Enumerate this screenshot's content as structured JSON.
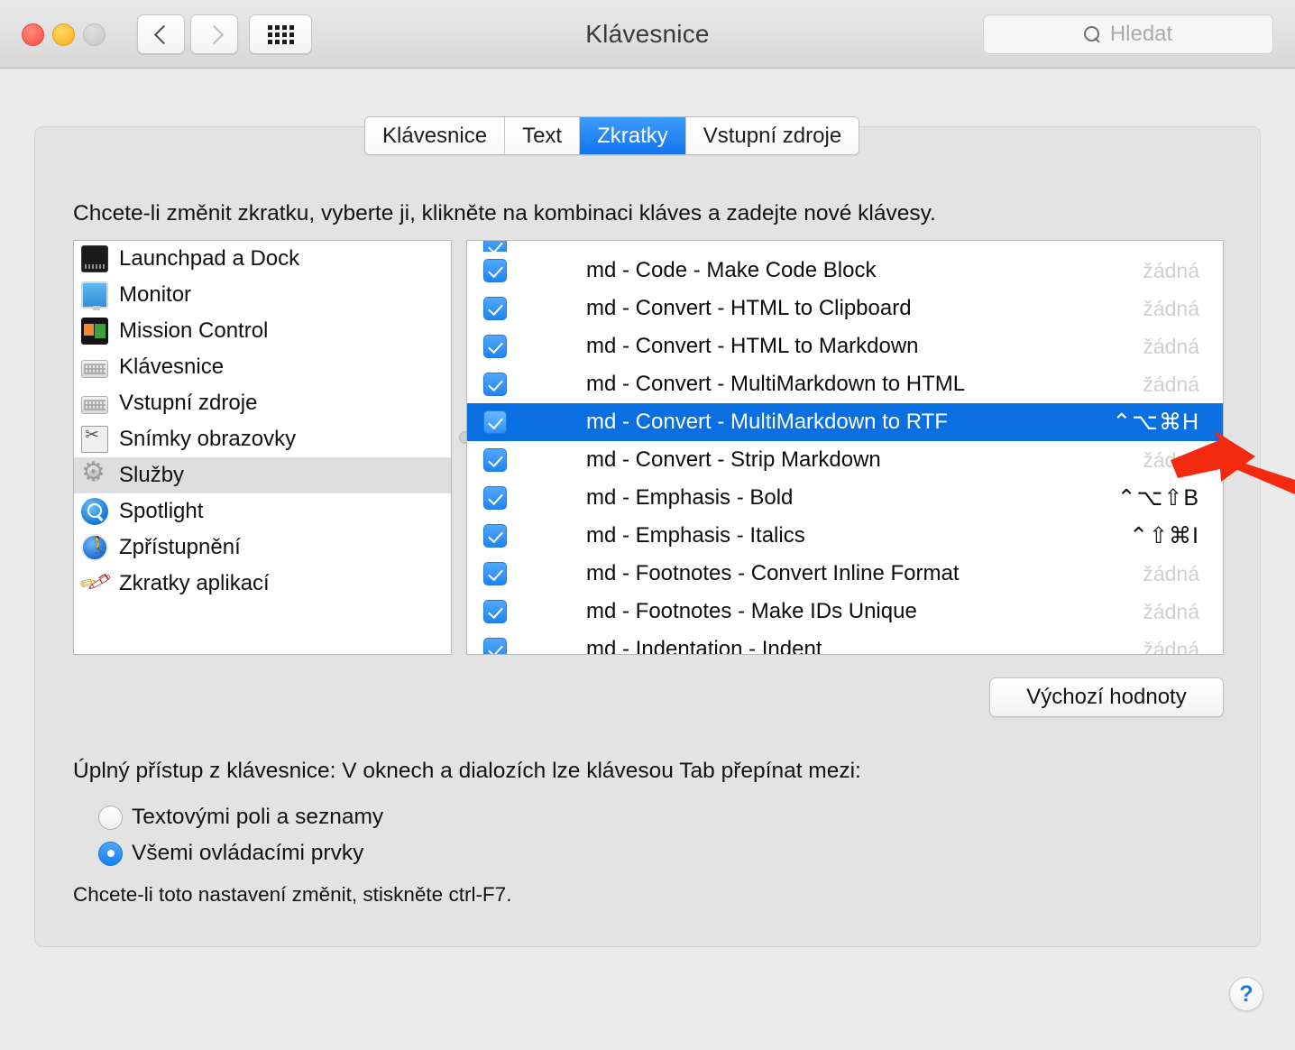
{
  "window": {
    "title": "Klávesnice",
    "search_placeholder": "Hledat",
    "back_icon": "chevron-left-icon",
    "forward_icon": "chevron-right-icon",
    "grid_icon": "show-all-grid-icon",
    "search_icon": "search-icon"
  },
  "tabs": [
    {
      "label": "Klávesnice",
      "active": false
    },
    {
      "label": "Text",
      "active": false
    },
    {
      "label": "Zkratky",
      "active": true
    },
    {
      "label": "Vstupní zdroje",
      "active": false
    }
  ],
  "hint": "Chcete-li změnit zkratku, vyberte ji, klikněte na kombinaci kláves a zadejte nové klávesy.",
  "sidebar": {
    "items": [
      {
        "label": "Launchpad a Dock",
        "icon": "launchpad-dock-icon",
        "selected": false
      },
      {
        "label": "Monitor",
        "icon": "monitor-icon",
        "selected": false
      },
      {
        "label": "Mission Control",
        "icon": "mission-control-icon",
        "selected": false
      },
      {
        "label": "Klávesnice",
        "icon": "keyboard-icon",
        "selected": false
      },
      {
        "label": "Vstupní zdroje",
        "icon": "input-sources-icon",
        "selected": false
      },
      {
        "label": "Snímky obrazovky",
        "icon": "screenshots-icon",
        "selected": false
      },
      {
        "label": "Služby",
        "icon": "services-gear-icon",
        "selected": true
      },
      {
        "label": "Spotlight",
        "icon": "spotlight-icon",
        "selected": false
      },
      {
        "label": "Zpřístupnění",
        "icon": "accessibility-icon",
        "selected": false
      },
      {
        "label": "Zkratky aplikací",
        "icon": "app-shortcuts-icon",
        "selected": false
      }
    ]
  },
  "shortcuts": {
    "none_label": "žádná",
    "rows": [
      {
        "name": "",
        "key": "",
        "checked": true,
        "selected": false,
        "partial": true
      },
      {
        "name": "md - Code - Make Code Block",
        "key": "žádná",
        "has_key": false,
        "checked": true,
        "selected": false
      },
      {
        "name": "md - Convert - HTML to Clipboard",
        "key": "žádná",
        "has_key": false,
        "checked": true,
        "selected": false
      },
      {
        "name": "md - Convert - HTML to Markdown",
        "key": "žádná",
        "has_key": false,
        "checked": true,
        "selected": false
      },
      {
        "name": "md - Convert - MultiMarkdown to HTML",
        "key": "žádná",
        "has_key": false,
        "checked": true,
        "selected": false
      },
      {
        "name": "md - Convert - MultiMarkdown to RTF",
        "key": "⌃⌥⌘H",
        "has_key": true,
        "checked": true,
        "selected": true
      },
      {
        "name": "md - Convert - Strip Markdown",
        "key": "žádná",
        "has_key": false,
        "checked": true,
        "selected": false
      },
      {
        "name": "md - Emphasis - Bold",
        "key": "⌃⌥⇧B",
        "has_key": true,
        "checked": true,
        "selected": false
      },
      {
        "name": "md - Emphasis - Italics",
        "key": "⌃⇧⌘I",
        "has_key": true,
        "checked": true,
        "selected": false
      },
      {
        "name": "md - Footnotes - Convert Inline Format",
        "key": "žádná",
        "has_key": false,
        "checked": true,
        "selected": false
      },
      {
        "name": "md - Footnotes - Make IDs Unique",
        "key": "žádná",
        "has_key": false,
        "checked": true,
        "selected": false
      },
      {
        "name": "md - Indentation - Indent",
        "key": "žádná",
        "has_key": false,
        "checked": true,
        "selected": false
      }
    ]
  },
  "defaults_button": "Výchozí hodnoty",
  "full_keyboard_access": {
    "title": "Úplný přístup z klávesnice: V oknech a dialozích lze klávesou Tab přepínat mezi:",
    "options": [
      {
        "label": "Textovými poli a seznamy",
        "selected": false
      },
      {
        "label": "Všemi ovládacími prvky",
        "selected": true
      }
    ],
    "footnote": "Chcete-li toto nastavení změnit, stiskněte ctrl-F7."
  },
  "help_button": "?",
  "colors": {
    "accent_blue": "#0a6fe0",
    "tab_active": "#1274f0",
    "annotation_red": "#f42a10",
    "window_bg": "#ebebeb",
    "panel_bg": "#e3e3e3"
  }
}
